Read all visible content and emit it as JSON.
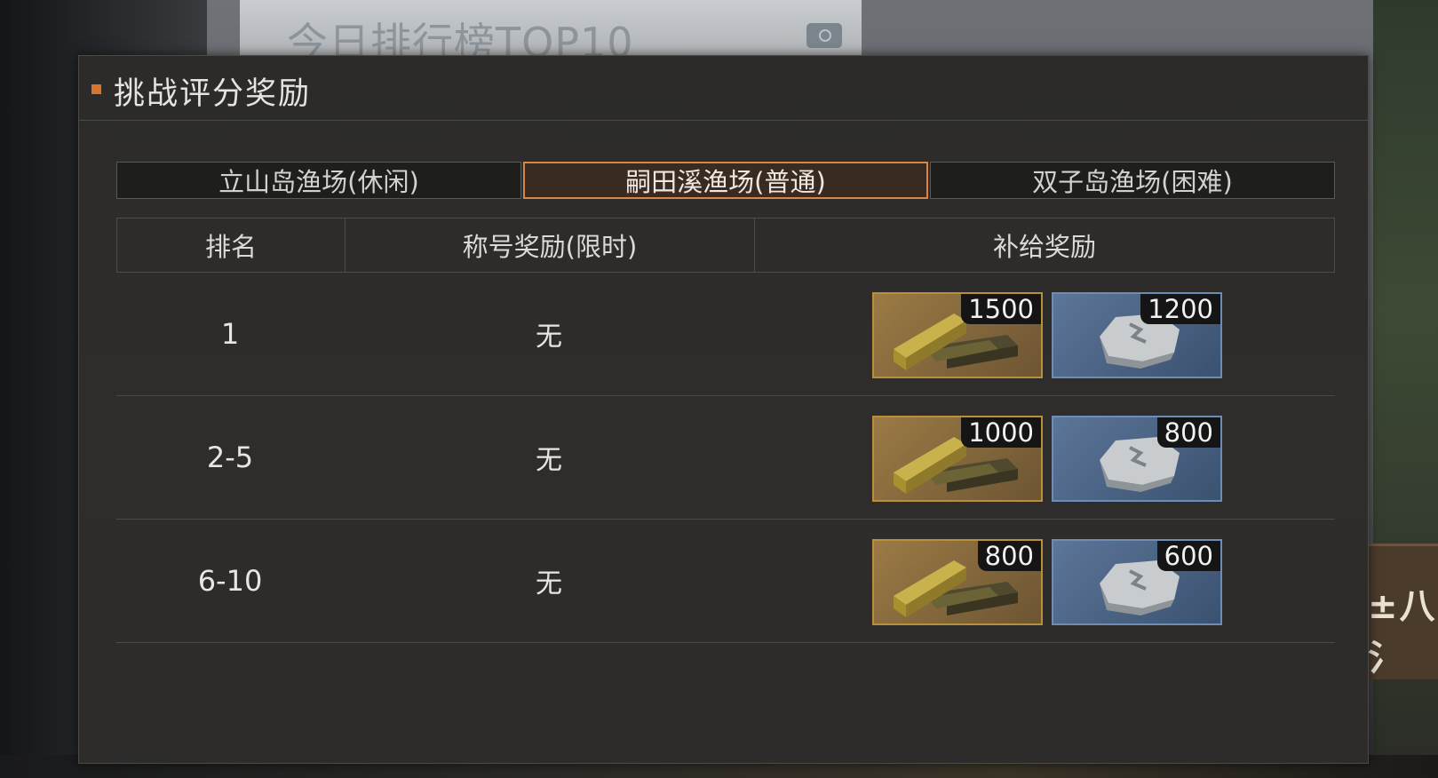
{
  "background": {
    "board_title": "今日排行榜TOP10",
    "sign_text": "±八氵"
  },
  "dialog": {
    "title": "挑战评分奖励",
    "tabs": [
      {
        "label": "立山岛渔场(休闲)",
        "active": false
      },
      {
        "label": "嗣田溪渔场(普通)",
        "active": true
      },
      {
        "label": "双子岛渔场(困难)",
        "active": false
      }
    ],
    "columns": {
      "rank": "排名",
      "title_reward": "称号奖励(限时)",
      "supply_reward": "补给奖励"
    },
    "rows": [
      {
        "rank": "1",
        "title_reward": "无",
        "gold_qty": "1500",
        "silver_qty": "1200"
      },
      {
        "rank": "2-5",
        "title_reward": "无",
        "gold_qty": "1000",
        "silver_qty": "800"
      },
      {
        "rank": "6-10",
        "title_reward": "无",
        "gold_qty": "800",
        "silver_qty": "600"
      }
    ]
  },
  "colors": {
    "accent": "#d88648",
    "header_mark": "#d9742e",
    "gold_frame": "#b98f3a",
    "silver_frame": "#6e8db4"
  },
  "icons": {
    "gold_item": "gold-bars-icon",
    "silver_item": "silver-ore-icon"
  }
}
